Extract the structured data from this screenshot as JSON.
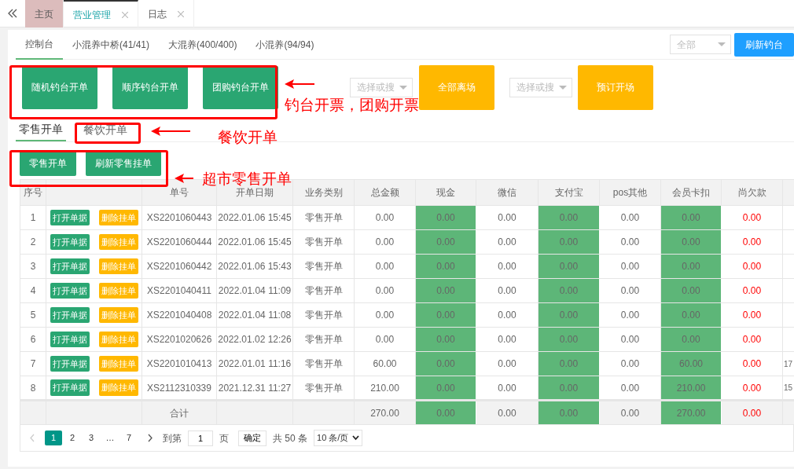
{
  "tabs": [
    {
      "label": "主页",
      "selected": false,
      "closable": false,
      "kind": "home"
    },
    {
      "label": "营业管理",
      "selected": true,
      "closable": true,
      "kind": "page"
    },
    {
      "label": "日志",
      "selected": false,
      "closable": true,
      "kind": "page"
    }
  ],
  "pond_tabs": [
    {
      "label": "控制台",
      "selected": true
    },
    {
      "label": "小混养中桥(41/41)",
      "selected": false
    },
    {
      "label": "大混养(400/400)",
      "selected": false
    },
    {
      "label": "小混养(94/94)",
      "selected": false
    }
  ],
  "pond_filter": {
    "value": "全部"
  },
  "refresh_button": "刷新钓台",
  "actions": [
    {
      "kind": "green",
      "label": "随机钓台开单"
    },
    {
      "kind": "green",
      "label": "顺序钓台开单"
    },
    {
      "kind": "green",
      "label": "团购钓台开单"
    },
    {
      "kind": "select",
      "placeholder": "选择或搜"
    },
    {
      "kind": "orange",
      "label": "全部离场"
    },
    {
      "kind": "select",
      "placeholder": "选择或搜"
    },
    {
      "kind": "orange",
      "label": "预订开场"
    }
  ],
  "order_tabs": [
    {
      "label": "零售开单",
      "selected": true
    },
    {
      "label": "餐饮开单",
      "selected": false
    }
  ],
  "retail_buttons": [
    "零售开单",
    "刷新零售挂单"
  ],
  "table": {
    "columns": [
      {
        "label": "序号",
        "kind": "plain"
      },
      {
        "kind": "actions"
      },
      {
        "label": "单号",
        "kind": "plain"
      },
      {
        "label": "开单日期",
        "kind": "plain"
      },
      {
        "label": "业务类别",
        "kind": "plain"
      },
      {
        "label": "总金额",
        "kind": "plain"
      },
      {
        "label": "现金",
        "kind": "green"
      },
      {
        "label": "微信",
        "kind": "plain"
      },
      {
        "label": "支付宝",
        "kind": "green"
      },
      {
        "label": "pos其他",
        "kind": "plain"
      },
      {
        "label": "会员卡扣",
        "kind": "green"
      },
      {
        "label": "尚欠款",
        "kind": "red"
      },
      {
        "kind": "edge"
      }
    ],
    "rows": [
      {
        "cells": [
          "1",
          [
            "打开单据",
            "删除挂单"
          ],
          "XS2201060443",
          "2022.01.06 15:45",
          "零售开单",
          "0.00",
          "0.00",
          "0.00",
          "0.00",
          "0.00",
          "0.00",
          "0.00",
          ""
        ]
      },
      {
        "cells": [
          "2",
          [
            "打开单据",
            "删除挂单"
          ],
          "XS2201060444",
          "2022.01.06 15:45",
          "零售开单",
          "0.00",
          "0.00",
          "0.00",
          "0.00",
          "0.00",
          "0.00",
          "0.00",
          ""
        ]
      },
      {
        "cells": [
          "3",
          [
            "打开单据",
            "删除挂单"
          ],
          "XS2201060442",
          "2022.01.06 15:43",
          "零售开单",
          "0.00",
          "0.00",
          "0.00",
          "0.00",
          "0.00",
          "0.00",
          "0.00",
          ""
        ]
      },
      {
        "cells": [
          "4",
          [
            "打开单据",
            "删除挂单"
          ],
          "XS2201040411",
          "2022.01.04 11:09",
          "零售开单",
          "0.00",
          "0.00",
          "0.00",
          "0.00",
          "0.00",
          "0.00",
          "0.00",
          ""
        ]
      },
      {
        "cells": [
          "5",
          [
            "打开单据",
            "删除挂单"
          ],
          "XS2201040408",
          "2022.01.04 11:08",
          "零售开单",
          "0.00",
          "0.00",
          "0.00",
          "0.00",
          "0.00",
          "0.00",
          "0.00",
          ""
        ]
      },
      {
        "cells": [
          "6",
          [
            "打开单据",
            "删除挂单"
          ],
          "XS2201020626",
          "2022.01.02 12:26",
          "零售开单",
          "0.00",
          "0.00",
          "0.00",
          "0.00",
          "0.00",
          "0.00",
          "0.00",
          ""
        ]
      },
      {
        "cells": [
          "7",
          [
            "打开单据",
            "删除挂单"
          ],
          "XS2201010413",
          "2022.01.01 11:16",
          "零售开单",
          "60.00",
          "0.00",
          "0.00",
          "0.00",
          "0.00",
          "60.00",
          "0.00",
          "17"
        ]
      },
      {
        "cells": [
          "8",
          [
            "打开单据",
            "删除挂单"
          ],
          "XS2112310339",
          "2021.12.31 11:27",
          "零售开单",
          "210.00",
          "0.00",
          "0.00",
          "0.00",
          "0.00",
          "210.00",
          "0.00",
          "15"
        ]
      }
    ],
    "total": {
      "cells": [
        "",
        "",
        "合计",
        "",
        "",
        "270.00",
        "0.00",
        "0.00",
        "0.00",
        "0.00",
        "270.00",
        "0.00",
        ""
      ]
    }
  },
  "pagination": {
    "pages": [
      {
        "label": "1",
        "selected": true
      },
      {
        "label": "2",
        "selected": false
      },
      {
        "label": "3",
        "selected": false
      },
      {
        "label": "…",
        "selected": false
      },
      {
        "label": "7",
        "selected": false
      }
    ],
    "goto_label": "到第",
    "goto_value": "1",
    "page_unit": "页",
    "confirm": "确定",
    "count": "共 50 条",
    "page_size": "10 条/页"
  },
  "annotations": [
    "钓台开票，团购开票",
    "餐饮开单",
    "超市零售开单"
  ]
}
